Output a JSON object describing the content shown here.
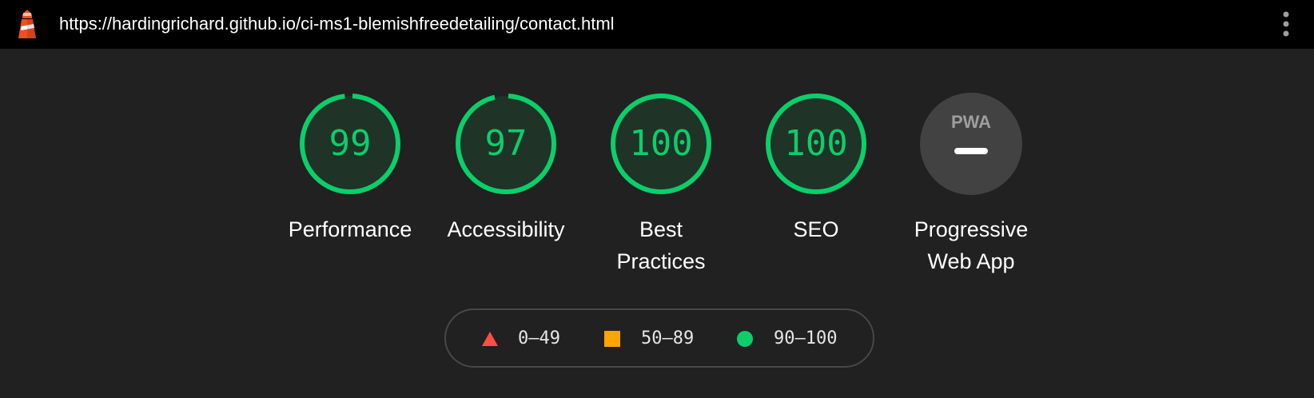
{
  "topbar": {
    "logo_icon": "lighthouse-icon",
    "url": "https://hardingrichard.github.io/ci-ms1-blemishfreedetailing/contact.html",
    "menu_icon": "kebab-menu-icon"
  },
  "gauges": [
    {
      "label": "Performance",
      "score": "99",
      "fraction": 0.99,
      "color": "#0cce6b"
    },
    {
      "label": "Accessibility",
      "score": "97",
      "fraction": 0.97,
      "color": "#0cce6b"
    },
    {
      "label": "Best Practices",
      "score": "100",
      "fraction": 1.0,
      "color": "#0cce6b"
    },
    {
      "label": "SEO",
      "score": "100",
      "fraction": 1.0,
      "color": "#0cce6b"
    },
    {
      "label": "Progressive Web App",
      "badge": "PWA",
      "icon": "pwa-badge-icon"
    }
  ],
  "legend": [
    {
      "range": "0–49",
      "shape": "triangle",
      "color": "#ff4e42"
    },
    {
      "range": "50–89",
      "shape": "square",
      "color": "#ffa400"
    },
    {
      "range": "90–100",
      "shape": "circle",
      "color": "#0cce6b"
    }
  ],
  "colors": {
    "background": "#212121",
    "topbar": "#000000",
    "gauge_fill": "#1f3327",
    "pwa_fill": "#424242",
    "legend_border": "#474747"
  }
}
